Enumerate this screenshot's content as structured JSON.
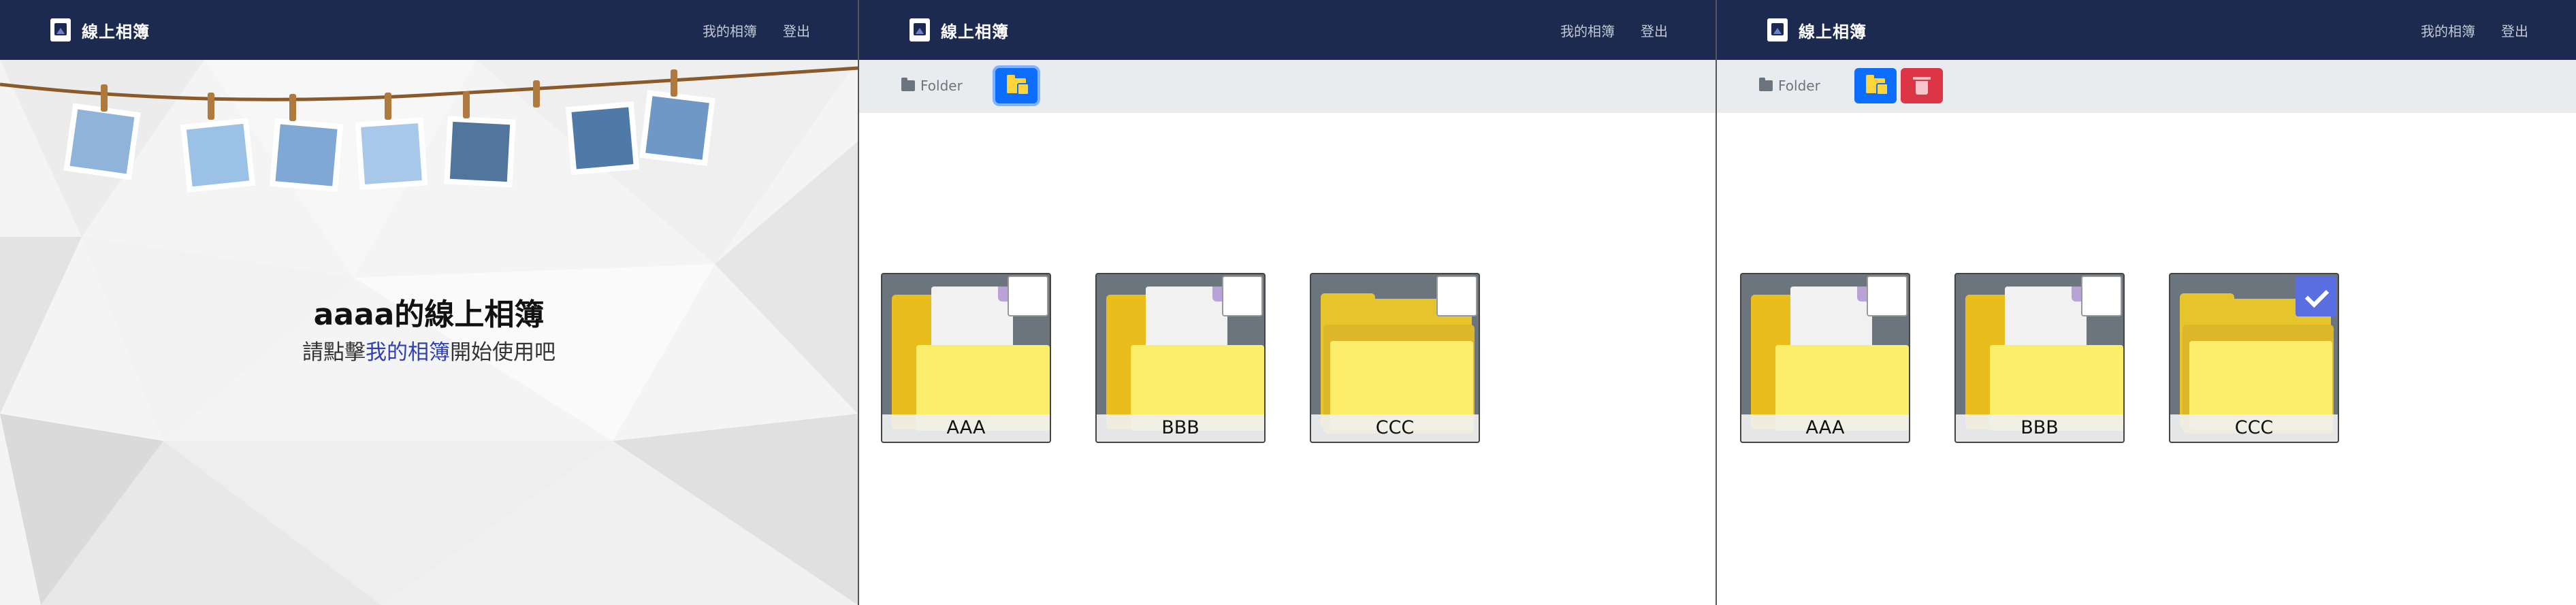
{
  "brand": {
    "title": "線上相簿"
  },
  "nav": {
    "my_album": "我的相簿",
    "logout": "登出"
  },
  "hero": {
    "title": "aaaa的線上相簿",
    "sub_before": "請點擊",
    "sub_link": "我的相簿",
    "sub_after": "開始使用吧"
  },
  "toolbar": {
    "folder_label": "Folder"
  },
  "folders": [
    {
      "name": "AAA"
    },
    {
      "name": "BBB"
    },
    {
      "name": "CCC"
    }
  ],
  "selection": {
    "panel3_selected": "CCC"
  },
  "colors": {
    "navbar": "#1b2a4e",
    "primary": "#0d6efd",
    "danger": "#dc3545",
    "check": "#5b6ee1"
  }
}
